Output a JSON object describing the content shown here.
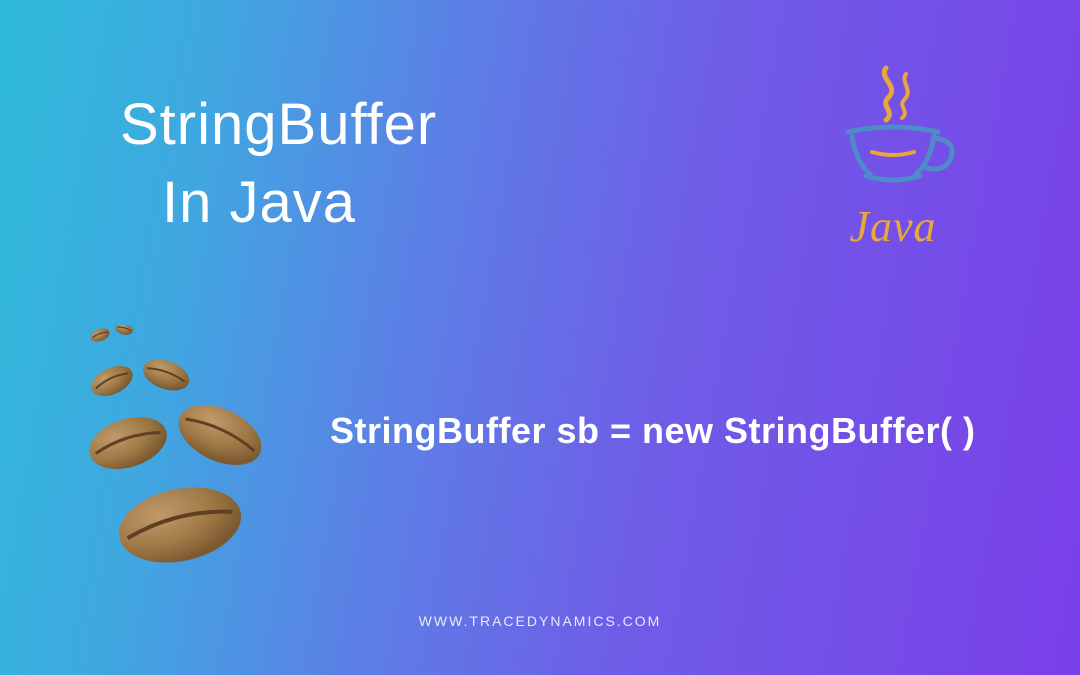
{
  "title_line1": "StringBuffer",
  "title_line2": "In Java",
  "code_snippet": "StringBuffer sb = new StringBuffer( )",
  "footer_url": "WWW.TRACEDYNAMICS.COM",
  "java_logo_text": "Java",
  "colors": {
    "java_orange": "#e8a73a",
    "java_blue": "#4f8bc9",
    "bean_light": "#b48a5a",
    "bean_dark": "#8a6238"
  }
}
